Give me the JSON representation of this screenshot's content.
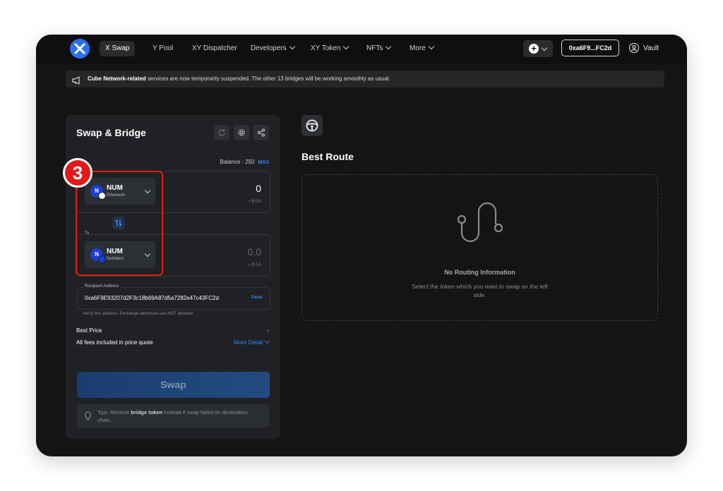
{
  "nav": {
    "items": [
      {
        "label": "X Swap"
      },
      {
        "label": "Y Pool"
      },
      {
        "label": "XY Dispatcher"
      },
      {
        "label": "Developers"
      },
      {
        "label": "XY Token"
      },
      {
        "label": "NFTs"
      },
      {
        "label": "More"
      }
    ],
    "wallet_address": "0xa6F9...FC2d",
    "vault_label": "Vault"
  },
  "banner": {
    "bold": "Cube Network-related",
    "text": " services are now temporarily suspended. The other 13 bridges will be working smoothly as usual."
  },
  "swap": {
    "title": "Swap & Bridge",
    "balance": "Balance : 250",
    "max_label": "MAX",
    "from": {
      "symbol": "NUM",
      "chain": "Ethereum",
      "amount": "0",
      "usd": "≈ $ 0.0"
    },
    "to_label": "To",
    "to": {
      "symbol": "NUM",
      "chain": "Numbers",
      "amount": "0.0",
      "usd": "≈ $ 0.0"
    },
    "recipient_label": "Recipient Address",
    "recipient_address": "0xa6F9E93207d2F3c18b69A87d5a7282e47c43FC2d",
    "paste_label": "Paste",
    "verify_note": "Verify this address. Exchange addresses are NOT allowed!",
    "best_price_label": "Best Price",
    "best_price_value": "-",
    "fees_label": "All fees included in price quote",
    "more_detail_label": "More Detail",
    "swap_button": "Swap",
    "tips_prefix": "Tips: Receive ",
    "tips_bold": "bridge token",
    "tips_suffix": " instead if swap failed on destination chain."
  },
  "annotation": {
    "step": "3",
    "color": "#e21a1a"
  },
  "route": {
    "title": "Best Route",
    "empty_title": "No Routing Information",
    "empty_text": "Select the token which you want to swap on the left side."
  },
  "colors": {
    "accent": "#3b82f6",
    "frame": "#141414",
    "card": "#1f2124"
  }
}
